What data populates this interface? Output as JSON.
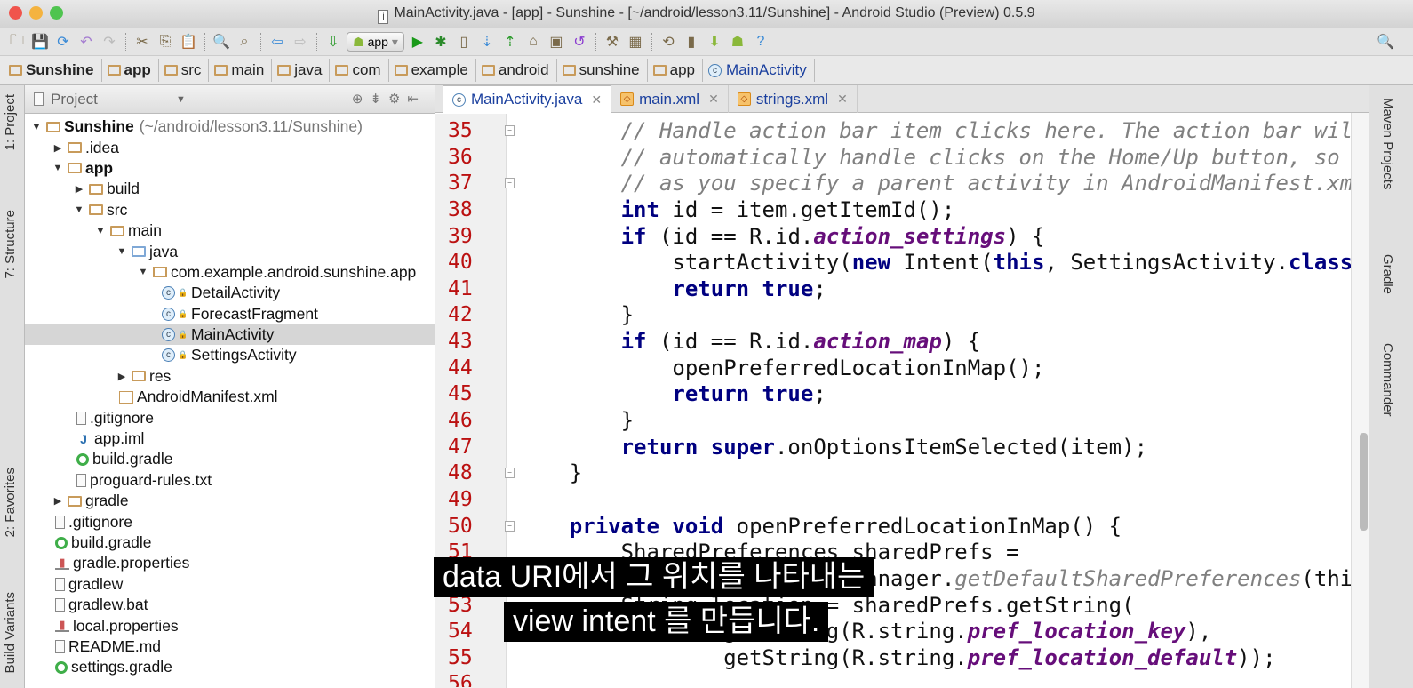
{
  "window": {
    "title": "MainActivity.java - [app] - Sunshine - [~/android/lesson3.11/Sunshine] - Android Studio (Preview) 0.5.9",
    "file_icon": "j"
  },
  "toolbar": {
    "run_config": "app",
    "icons": [
      "open-folder",
      "save",
      "sync",
      "undo",
      "redo",
      "cut",
      "copy",
      "paste",
      "find",
      "replace",
      "back",
      "forward",
      "make",
      "run-config",
      "run",
      "debug",
      "device",
      "vcs-update",
      "vcs-commit",
      "sdk",
      "avd",
      "revert",
      "settings",
      "structure",
      "sync-gradle",
      "device-monitor",
      "android-sdk",
      "android",
      "help"
    ]
  },
  "breadcrumbs": [
    "Sunshine",
    "app",
    "src",
    "main",
    "java",
    "com",
    "example",
    "android",
    "sunshine",
    "app",
    "MainActivity"
  ],
  "left_strip": {
    "project": "1: Project",
    "structure": "7: Structure",
    "favorites": "2: Favorites",
    "build_variants": "Build Variants"
  },
  "project_panel": {
    "title": "Project",
    "tree": [
      {
        "d": 0,
        "a": "▼",
        "i": "folder",
        "t": "Sunshine",
        "b": true,
        "x": "(~/android/lesson3.11/Sunshine)"
      },
      {
        "d": 1,
        "a": "▶",
        "i": "folder",
        "t": ".idea"
      },
      {
        "d": 1,
        "a": "▼",
        "i": "folder",
        "t": "app",
        "b": true
      },
      {
        "d": 2,
        "a": "▶",
        "i": "folder",
        "t": "build"
      },
      {
        "d": 2,
        "a": "▼",
        "i": "folder",
        "t": "src"
      },
      {
        "d": 3,
        "a": "▼",
        "i": "folder",
        "t": "main"
      },
      {
        "d": 4,
        "a": "▼",
        "i": "bluefolder",
        "t": "java"
      },
      {
        "d": 5,
        "a": "▼",
        "i": "pkg",
        "t": "com.example.android.sunshine.app"
      },
      {
        "d": 6,
        "a": "",
        "i": "class",
        "t": "DetailActivity"
      },
      {
        "d": 6,
        "a": "",
        "i": "class",
        "t": "ForecastFragment"
      },
      {
        "d": 6,
        "a": "",
        "i": "class",
        "t": "MainActivity",
        "sel": true
      },
      {
        "d": 6,
        "a": "",
        "i": "class",
        "t": "SettingsActivity"
      },
      {
        "d": 4,
        "a": "▶",
        "i": "folder",
        "t": "res"
      },
      {
        "d": 4,
        "a": "",
        "i": "xml",
        "t": "AndroidManifest.xml"
      },
      {
        "d": 2,
        "a": "",
        "i": "file",
        "t": ".gitignore"
      },
      {
        "d": 2,
        "a": "",
        "i": "iml",
        "t": "app.iml"
      },
      {
        "d": 2,
        "a": "",
        "i": "gradle",
        "t": "build.gradle"
      },
      {
        "d": 2,
        "a": "",
        "i": "file",
        "t": "proguard-rules.txt"
      },
      {
        "d": 1,
        "a": "▶",
        "i": "folder",
        "t": "gradle"
      },
      {
        "d": 1,
        "a": "",
        "i": "file",
        "t": ".gitignore"
      },
      {
        "d": 1,
        "a": "",
        "i": "gradle",
        "t": "build.gradle"
      },
      {
        "d": 1,
        "a": "",
        "i": "props",
        "t": "gradle.properties"
      },
      {
        "d": 1,
        "a": "",
        "i": "file",
        "t": "gradlew"
      },
      {
        "d": 1,
        "a": "",
        "i": "file",
        "t": "gradlew.bat"
      },
      {
        "d": 1,
        "a": "",
        "i": "props",
        "t": "local.properties"
      },
      {
        "d": 1,
        "a": "",
        "i": "file",
        "t": "README.md"
      },
      {
        "d": 1,
        "a": "",
        "i": "gradle",
        "t": "settings.gradle"
      }
    ]
  },
  "editor": {
    "tabs": [
      {
        "label": "MainActivity.java",
        "icon": "class",
        "active": true
      },
      {
        "label": "main.xml",
        "icon": "xml"
      },
      {
        "label": "strings.xml",
        "icon": "xml"
      }
    ],
    "lines": [
      {
        "n": "35",
        "f": true,
        "s": [
          [
            "",
            "        "
          ],
          [
            "cm",
            "// Handle action bar item clicks here. The action bar will"
          ]
        ]
      },
      {
        "n": "36",
        "s": [
          [
            "",
            "        "
          ],
          [
            "cm",
            "// automatically handle clicks on the Home/Up button, so long"
          ]
        ]
      },
      {
        "n": "37",
        "f": true,
        "s": [
          [
            "",
            "        "
          ],
          [
            "cm",
            "// as you specify a parent activity in AndroidManifest.xml."
          ]
        ]
      },
      {
        "n": "38",
        "s": [
          [
            "",
            "        "
          ],
          [
            "kw",
            "int"
          ],
          [
            "",
            " id = item.getItemId();"
          ]
        ]
      },
      {
        "n": "39",
        "s": [
          [
            "",
            "        "
          ],
          [
            "kw",
            "if"
          ],
          [
            "",
            " (id == R.id."
          ],
          [
            "fld",
            "action_settings"
          ],
          [
            "",
            ") {"
          ]
        ]
      },
      {
        "n": "40",
        "s": [
          [
            "",
            "            startActivity("
          ],
          [
            "kw",
            "new"
          ],
          [
            "",
            " Intent("
          ],
          [
            "kw",
            "this"
          ],
          [
            "",
            ", SettingsActivity."
          ],
          [
            "kw",
            "class"
          ],
          [
            "",
            "));"
          ]
        ]
      },
      {
        "n": "41",
        "s": [
          [
            "",
            "            "
          ],
          [
            "kw",
            "return true"
          ],
          [
            "",
            ";"
          ]
        ]
      },
      {
        "n": "42",
        "s": [
          [
            "",
            "        }"
          ]
        ]
      },
      {
        "n": "43",
        "s": [
          [
            "",
            "        "
          ],
          [
            "kw",
            "if"
          ],
          [
            "",
            " (id == R.id."
          ],
          [
            "fld",
            "action_map"
          ],
          [
            "",
            ") {"
          ]
        ]
      },
      {
        "n": "44",
        "s": [
          [
            "",
            "            openPreferredLocationInMap();"
          ]
        ]
      },
      {
        "n": "45",
        "s": [
          [
            "",
            "            "
          ],
          [
            "kw",
            "return true"
          ],
          [
            "",
            ";"
          ]
        ]
      },
      {
        "n": "46",
        "s": [
          [
            "",
            "        }"
          ]
        ]
      },
      {
        "n": "47",
        "s": [
          [
            "",
            "        "
          ],
          [
            "kw",
            "return super"
          ],
          [
            "",
            ".onOptionsItemSelected(item);"
          ]
        ]
      },
      {
        "n": "48",
        "f": true,
        "s": [
          [
            "",
            "    }"
          ]
        ]
      },
      {
        "n": "49",
        "s": []
      },
      {
        "n": "50",
        "f": true,
        "s": [
          [
            "",
            "    "
          ],
          [
            "kw",
            "private void"
          ],
          [
            "",
            " openPreferredLocationInMap() {"
          ]
        ]
      },
      {
        "n": "51",
        "s": [
          [
            "",
            "        SharedPreferences sharedPrefs ="
          ]
        ]
      },
      {
        "n": "52",
        "s": [
          [
            "",
            "                PreferenceManager."
          ],
          [
            "cm",
            "getDefaultSharedPreferences"
          ],
          [
            "",
            "(this);"
          ]
        ]
      },
      {
        "n": "53",
        "s": [
          [
            "",
            "        String location = sharedPrefs.getString("
          ]
        ]
      },
      {
        "n": "54",
        "s": [
          [
            "",
            "                getString(R.string."
          ],
          [
            "fld",
            "pref_location_key"
          ],
          [
            "",
            "),"
          ]
        ]
      },
      {
        "n": "55",
        "s": [
          [
            "",
            "                getString(R.string."
          ],
          [
            "fld",
            "pref_location_default"
          ],
          [
            "",
            "));"
          ]
        ]
      },
      {
        "n": "56",
        "s": []
      }
    ]
  },
  "right_strip": {
    "maven": "Maven Projects",
    "gradle": "Gradle",
    "commander": "Commander"
  },
  "subtitles": [
    "data URI에서 그 위치를 나타내는",
    "view intent 를 만듭니다."
  ],
  "colors": {
    "keyword": "#000080",
    "comment": "#808080",
    "field": "#660e7a",
    "line_number": "#b11111"
  }
}
